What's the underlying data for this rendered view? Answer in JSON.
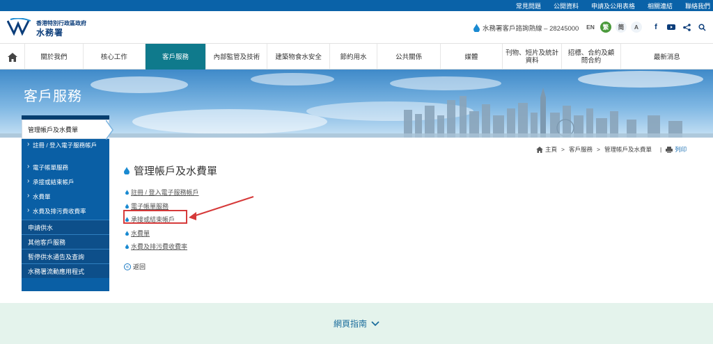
{
  "topbar": {
    "links": [
      "常見問題",
      "公開資料",
      "申請及公用表格",
      "相關連結",
      "聯絡我們"
    ]
  },
  "header": {
    "org_line1": "香港特別行政區政府",
    "org_line2": "水務署",
    "hotline": "水務署客戶諮詢熱線 – 28245000",
    "lang_en": "EN",
    "lang_tc": "繁",
    "lang_sc": "简",
    "font_size": "A"
  },
  "nav": {
    "items": [
      "關於我們",
      "核心工作",
      "客戶服務",
      "內部監管及技術",
      "建築物食水安全",
      "節約用水",
      "公共關係",
      "媒體",
      "刊物、短片及統計資料",
      "招標、合約及顧問合約",
      "最新消息"
    ],
    "active_index": 2
  },
  "banner": {
    "title": "客戶服務"
  },
  "sidebar": {
    "current": "管理帳戶及水費單",
    "sub_items": [
      "註冊 / 登入電子服務帳戶",
      "電子帳單服務",
      "承接或結束帳戶",
      "水費單",
      "水費及排污費收費率"
    ],
    "main_items": [
      "申請供水",
      "其他客戶服務",
      "暫停供水通告及查詢",
      "水務署流動應用程式"
    ]
  },
  "breadcrumb": {
    "home": "主頁",
    "sep": ">",
    "level1": "客戶服務",
    "level2": "管理帳戶及水費單",
    "print": "列印"
  },
  "content": {
    "title": "管理帳戶及水費單",
    "links": [
      "註冊 / 登入電子服務帳戶",
      "電子帳單服務",
      "承接或結束帳戶",
      "水費單",
      "水費及排污費收費率"
    ],
    "highlighted_index": 2,
    "back": "返回"
  },
  "footer": {
    "sitemap": "網頁指南"
  },
  "colors": {
    "topbar": "#0a62a8",
    "nav_active": "#0f7a8c",
    "sidebar": "#0a5fa5",
    "highlight": "#d63a3a",
    "footer": "#e4f3ec"
  }
}
